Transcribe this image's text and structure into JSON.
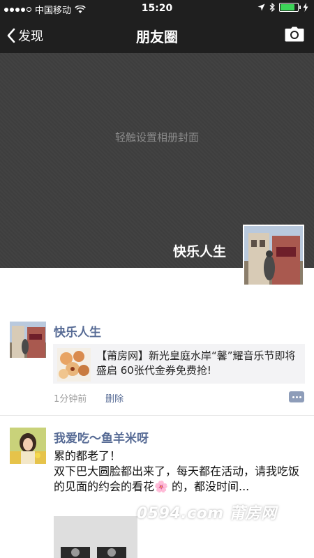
{
  "status_bar": {
    "carrier": "中国移动",
    "time": "15:20",
    "battery_level": 0.9,
    "battery_color": "#3cd458"
  },
  "nav": {
    "back_label": "发现",
    "title": "朋友圈",
    "back_icon": "chevron-left-icon",
    "camera_icon": "camera-icon"
  },
  "cover": {
    "hint": "轻触设置相册封面",
    "profile_name": "快乐人生"
  },
  "posts": [
    {
      "author": "快乐人生",
      "share_title": "【莆房网】新光皇庭水岸“馨”耀音乐节即将盛启 60张代金券免费抢!",
      "time": "1分钟前",
      "delete_label": "删除"
    },
    {
      "author": "我爱吃～鱼羊米呀",
      "text_line1": "累的都老了！",
      "text_body": "双下巴大圆脸都出来了，每天都在活动，请我吃饭的见面的约会的看花🌸 的，都没时间..."
    }
  ],
  "watermark": "0594.com 莆房网",
  "colors": {
    "bar_bg": "#1f1f1f",
    "name_link": "#576b95",
    "meta_gray": "#9b9b9b",
    "card_bg": "#f3f3f5"
  }
}
